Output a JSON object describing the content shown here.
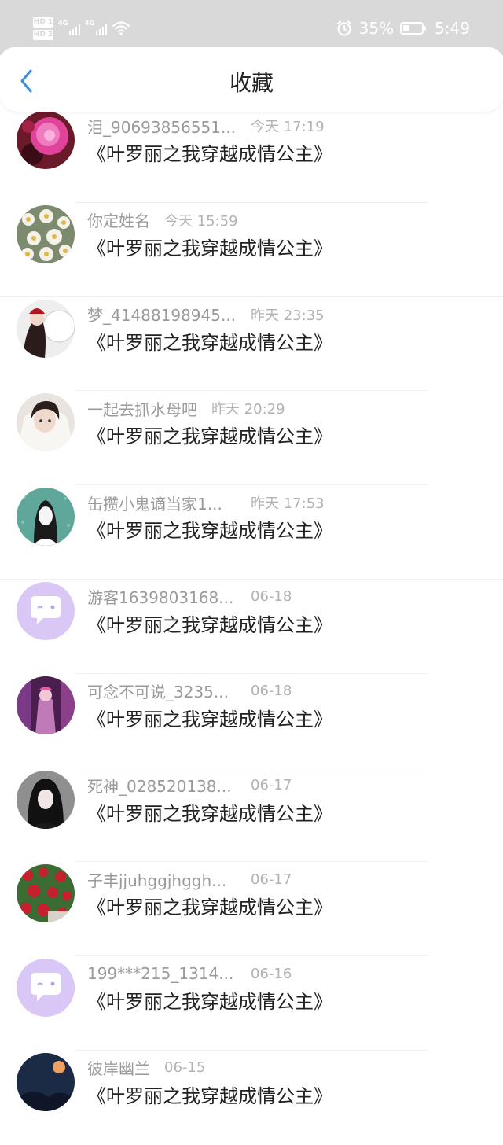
{
  "status_bar": {
    "hd1": "HD 1",
    "hd2": "HD 2",
    "net1": "4G",
    "net2": "4G",
    "battery_pct": "35%",
    "battery_level": 0.35,
    "time": "5:49",
    "icons": [
      "hd-icon",
      "signal-icon",
      "wifi-icon",
      "alarm-icon",
      "battery-icon"
    ],
    "color": "#d9d9d9"
  },
  "header": {
    "title": "收藏",
    "back_icon": "chevron-left-icon",
    "accent": "#3a8ee6"
  },
  "items": [
    {
      "user": "泪_90693856551...",
      "time": "今天 17:19",
      "book": "《叶罗丽之我穿越成情公主》",
      "avatar": "pink-flower"
    },
    {
      "user": "你定姓名",
      "time": "今天 15:59",
      "book": "《叶罗丽之我穿越成情公主》",
      "avatar": "white-flowers"
    },
    {
      "user": "梦_41488198945...",
      "time": "昨天 23:35",
      "book": "《叶罗丽之我穿越成情公主》",
      "avatar": "girl-lion"
    },
    {
      "user": "一起去抓水母吧",
      "time": "昨天 20:29",
      "book": "《叶罗丽之我穿越成情公主》",
      "avatar": "girl-white"
    },
    {
      "user": "缶攒小鬼谪当家1...",
      "time": "昨天 17:53",
      "book": "《叶罗丽之我穿越成情公主》",
      "avatar": "teal-girl"
    },
    {
      "user": "游客1639803168...",
      "time": "06-18",
      "book": "《叶罗丽之我穿越成情公主》",
      "avatar": "default"
    },
    {
      "user": "可念不可说_3235...",
      "time": "06-18",
      "book": "《叶罗丽之我穿越成情公主》",
      "avatar": "purple-girl"
    },
    {
      "user": "死神_028520138...",
      "time": "06-17",
      "book": "《叶罗丽之我穿越成情公主》",
      "avatar": "dark-girl"
    },
    {
      "user": "子丰jjuhggjhggh...",
      "time": "06-17",
      "book": "《叶罗丽之我穿越成情公主》",
      "avatar": "roses"
    },
    {
      "user": "199***215_1314...",
      "time": "06-16",
      "book": "《叶罗丽之我穿越成情公主》",
      "avatar": "default"
    },
    {
      "user": "彼岸幽兰",
      "time": "06-15",
      "book": "《叶罗丽之我穿越成情公主》",
      "avatar": "night"
    }
  ]
}
